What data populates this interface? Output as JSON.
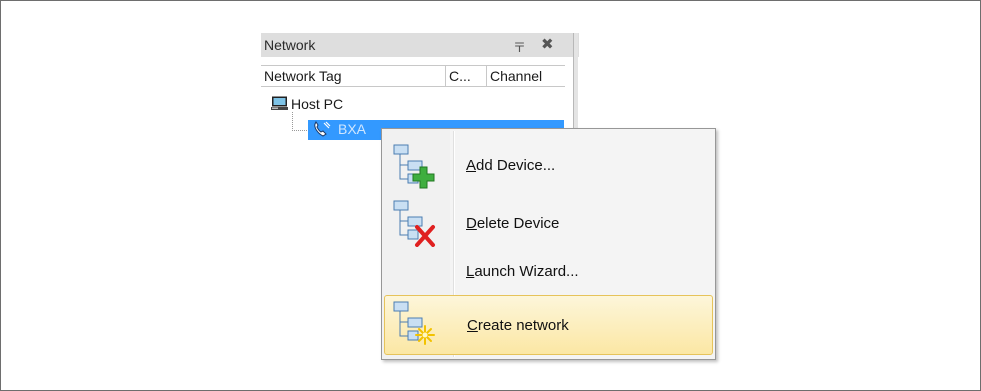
{
  "panel": {
    "title": "Network",
    "pin_glyph": "〒",
    "close_glyph": "✖",
    "columns": [
      "Network Tag",
      "C...",
      "Channel"
    ],
    "tree": {
      "root_label": "Host PC",
      "root_icon": "computer-icon",
      "child_label": "BXA",
      "child_icon": "phone-icon",
      "child_selected": true
    }
  },
  "context_menu": {
    "items": [
      {
        "mnemonic": "A",
        "rest": "dd Device...",
        "icon": "add-device-icon"
      },
      {
        "mnemonic": "D",
        "rest": "elete Device",
        "icon": "delete-device-icon"
      },
      {
        "mnemonic": "L",
        "rest": "aunch Wizard...",
        "icon": ""
      },
      {
        "mnemonic": "C",
        "rest": "reate network",
        "icon": "create-network-icon",
        "highlighted": true
      }
    ]
  },
  "colors": {
    "selection": "#3399ff",
    "menu_highlight": "#fbe7a4",
    "add_green": "#3fae3f",
    "delete_red": "#e02020"
  }
}
